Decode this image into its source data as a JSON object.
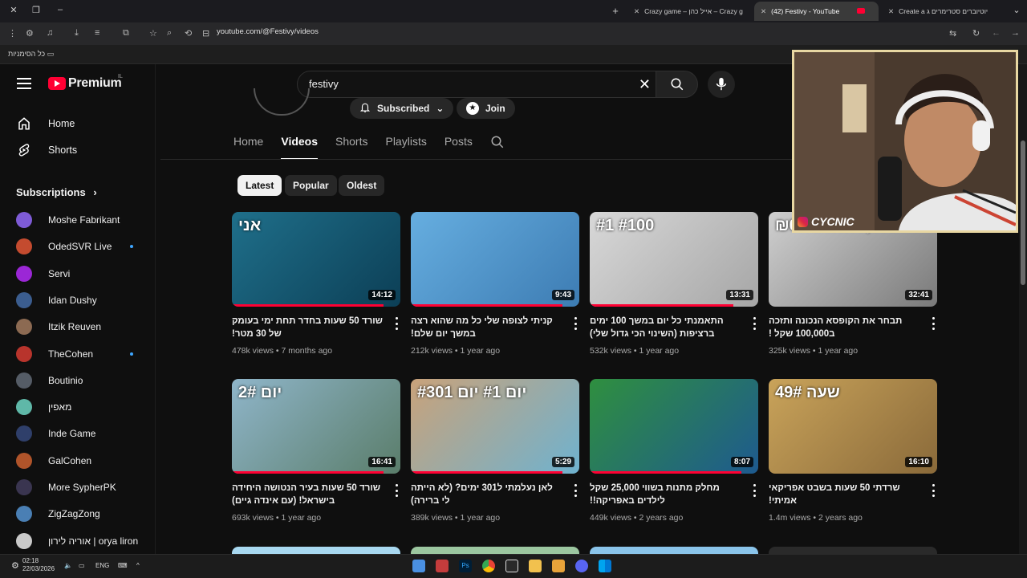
{
  "browser": {
    "tabs": [
      {
        "title": "Create a יוטיוברים סטרימרים ג",
        "active": false
      },
      {
        "title": "(42) Festivy - YouTube",
        "active": true
      },
      {
        "title": "Crazy game – אייל כהן – Crazy g",
        "active": false
      }
    ],
    "url": "youtube.com/@Festivy/videos",
    "bookmarks_label": "כל הסימניות"
  },
  "youtube": {
    "logo_text": "Premium",
    "country_code": "IL",
    "search_value": "festivy",
    "nav": [
      {
        "label": "Home",
        "icon": "home-icon"
      },
      {
        "label": "Shorts",
        "icon": "shorts-icon"
      }
    ],
    "subscriptions_title": "Subscriptions",
    "subscriptions": [
      {
        "name": "Moshe Fabrikant",
        "color": "#7e5bd6",
        "live_dot": false
      },
      {
        "name": "OdedSVR Live",
        "color": "#c44b2f",
        "live_dot": true
      },
      {
        "name": "Servi",
        "color": "#9b27d6",
        "live_dot": false
      },
      {
        "name": "Idan Dushy",
        "color": "#3b5d8f",
        "live_dot": false
      },
      {
        "name": "Itzik Reuven",
        "color": "#8c6a52",
        "live_dot": false
      },
      {
        "name": "TheCohen",
        "color": "#b8342c",
        "live_dot": true
      },
      {
        "name": "Boutinio",
        "color": "#555c66",
        "live_dot": false
      },
      {
        "name": "מאפין",
        "color": "#5fb8a8",
        "live_dot": false
      },
      {
        "name": "Inde Game",
        "color": "#2f3f6a",
        "live_dot": false
      },
      {
        "name": "GalCohen",
        "color": "#b0542a",
        "live_dot": false
      },
      {
        "name": "More SypherPK",
        "color": "#3a3550",
        "live_dot": false
      },
      {
        "name": "ZigZagZong",
        "color": "#4a7fb4",
        "live_dot": false
      },
      {
        "name": "אוריה לירון | orya liron",
        "color": "#c9c9c9",
        "live_dot": false
      }
    ],
    "channel": {
      "subscribed_label": "Subscribed",
      "join_label": "Join",
      "tabs": [
        "Home",
        "Videos",
        "Shorts",
        "Playlists",
        "Posts"
      ],
      "active_tab": "Videos",
      "filters": [
        "Latest",
        "Popular",
        "Oldest"
      ],
      "active_filter": "Latest"
    },
    "videos": [
      {
        "title": "שורד 50 שעות בחדר תחת ימי בעומק של 30 מטר!",
        "views": "478k views",
        "age": "7 months ago",
        "duration": "14:12",
        "thumb_text": "אני",
        "bg1": "#1f6f8a",
        "bg2": "#0c3f56",
        "progress": 0.9
      },
      {
        "title": "קניתי לצופה שלי כל מה שהוא רצה במשך יום שלם!",
        "views": "212k views",
        "age": "1 year ago",
        "duration": "9:43",
        "thumb_text": "",
        "bg1": "#66aee0",
        "bg2": "#3d7cb3",
        "progress": 0.9
      },
      {
        "title": "התאמנתי כל יום במשך 100 ימים ברציפות (השינוי הכי גדול שלי)",
        "views": "532k views",
        "age": "1 year ago",
        "duration": "13:31",
        "thumb_text": "#1  #100",
        "bg1": "#d8d8d8",
        "bg2": "#a6a6a6",
        "progress": 0.85
      },
      {
        "title": "תבחר את הקופסא הנכונה ותזכה ב100,000 שקל !",
        "views": "325k views",
        "age": "1 year ago",
        "duration": "32:41",
        "thumb_text": "₪0.01   ₪100,000",
        "bg1": "#cfcfcf",
        "bg2": "#7a7a7a",
        "progress": 0.0
      },
      {
        "title": "שורד 50 שעות בעיר הנטושה היחידה בישראל! (עם אינדה גיים)",
        "views": "693k views",
        "age": "1 year ago",
        "duration": "16:41",
        "thumb_text": "יום 2#",
        "bg1": "#8fb5c9",
        "bg2": "#5a7d6a",
        "progress": 0.9
      },
      {
        "title": "לאן נעלמתי ל301 ימים? (לא הייתה לי ברירה)",
        "views": "389k views",
        "age": "1 year ago",
        "duration": "5:29",
        "thumb_text": "#301 יום   #1 יום",
        "bg1": "#c9a27a",
        "bg2": "#6fb2cf",
        "progress": 0.9
      },
      {
        "title": "מחלק מתנות בשווי 25,000 שקל לילדים באפריקה!!",
        "views": "449k views",
        "age": "2 years ago",
        "duration": "8:07",
        "thumb_text": "",
        "bg1": "#2f8f3f",
        "bg2": "#1e5a8f",
        "progress": 0.9
      },
      {
        "title": "שרדתי 50 שעות בשבט אפריקאי אמיתי!",
        "views": "1.4m views",
        "age": "2 years ago",
        "duration": "16:10",
        "thumb_text": "שעה 49#",
        "bg1": "#c9a35a",
        "bg2": "#8a6a3a",
        "progress": 0.0
      }
    ]
  },
  "pip": {
    "label": "CYCNIC"
  },
  "taskbar": {
    "time": "02:18",
    "date": "22/03/2026",
    "lang": "ENG"
  }
}
